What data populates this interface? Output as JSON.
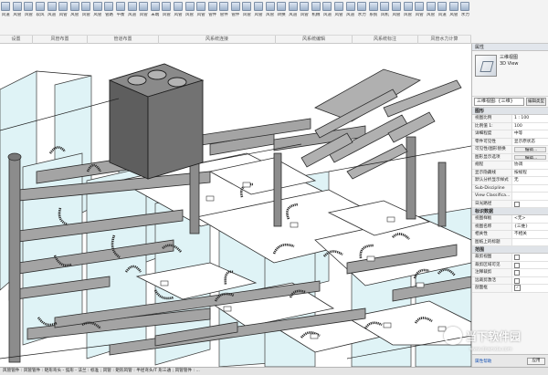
{
  "ribbon": {
    "buttons": [
      "风道",
      "风管",
      "风管",
      "软风",
      "风道",
      "风管",
      "风管",
      "风管",
      "风管",
      "管路",
      "平衡",
      "风道",
      "风管",
      "末端",
      "风管",
      "风管",
      "风管",
      "风管",
      "管件",
      "管件",
      "管件",
      "风管",
      "风管",
      "风管",
      "转换",
      "风道",
      "风管",
      "机械",
      "风道",
      "风管",
      "风道",
      "水力",
      "系统",
      "风机",
      "风管",
      "风管",
      "风管",
      "风管",
      "风道",
      "风管",
      "水力"
    ],
    "groups": [
      {
        "label": "设置"
      },
      {
        "label": "风管布置"
      },
      {
        "label": "管道布置"
      },
      {
        "label": "风系统连接"
      },
      {
        "label": "风系统编辑"
      },
      {
        "label": "风系统标注"
      },
      {
        "label": "风管水力计算"
      }
    ]
  },
  "properties": {
    "title": "属性",
    "type_name": "三维视图",
    "type_name_en": "3D View",
    "filter_value": "三维视图: {三维}",
    "edit_type_label": "编辑类型",
    "sections": [
      {
        "name": "图形",
        "rows": [
          {
            "key": "视图比例",
            "value": "1 : 100",
            "kind": "text"
          },
          {
            "key": "比例值 1:",
            "value": "100",
            "kind": "text"
          },
          {
            "key": "详细程度",
            "value": "中等",
            "kind": "text"
          },
          {
            "key": "零件可见性",
            "value": "显示原状态",
            "kind": "text"
          },
          {
            "key": "可见性/图形替换",
            "value": "编辑...",
            "kind": "button"
          },
          {
            "key": "图形显示选项",
            "value": "编辑...",
            "kind": "button"
          },
          {
            "key": "规程",
            "value": "协调",
            "kind": "text"
          },
          {
            "key": "显示隐藏线",
            "value": "按规程",
            "kind": "text"
          },
          {
            "key": "默认分析显示样式",
            "value": "无",
            "kind": "text"
          },
          {
            "key": "Sub-Discipline",
            "value": "",
            "kind": "text"
          },
          {
            "key": "View Classifica...",
            "value": "",
            "kind": "text"
          },
          {
            "key": "日光路径",
            "value": "",
            "kind": "checkbox"
          }
        ]
      },
      {
        "name": "标识数据",
        "rows": [
          {
            "key": "视图样板",
            "value": "<无>",
            "kind": "text"
          },
          {
            "key": "视图名称",
            "value": "{三维}",
            "kind": "text"
          },
          {
            "key": "相关性",
            "value": "不相关",
            "kind": "text"
          },
          {
            "key": "图纸上的标题",
            "value": "",
            "kind": "text"
          }
        ]
      },
      {
        "name": "范围",
        "rows": [
          {
            "key": "裁剪视图",
            "value": "",
            "kind": "checkbox"
          },
          {
            "key": "裁剪区域可见",
            "value": "",
            "kind": "checkbox"
          },
          {
            "key": "注释裁剪",
            "value": "",
            "kind": "checkbox"
          },
          {
            "key": "远裁剪激活",
            "value": "",
            "kind": "checkbox"
          },
          {
            "key": "剖面框",
            "value": "",
            "kind": "checked"
          }
        ]
      }
    ],
    "help_link": "属性帮助",
    "apply_label": "应用"
  },
  "status_bar": {
    "text": "风管管件 : 风管管件 : 矩形弯头 - 弧形 - 法兰 : 标准 ; 风管 : 矩形风管 : 半径弯头/T 形三通 ; 风管管件 : ..."
  },
  "watermark": {
    "text": "当下软件园",
    "url": "www.downxia.com"
  },
  "colors": {
    "ribbon_bg": "#f3f3f3",
    "panel_bg": "#f6f6f6",
    "model_line": "#2b2b2b",
    "duct_fill": "#9a9a9a",
    "glass_tint": "#dff3f6",
    "ahu_fill": "#6f6f6f"
  }
}
